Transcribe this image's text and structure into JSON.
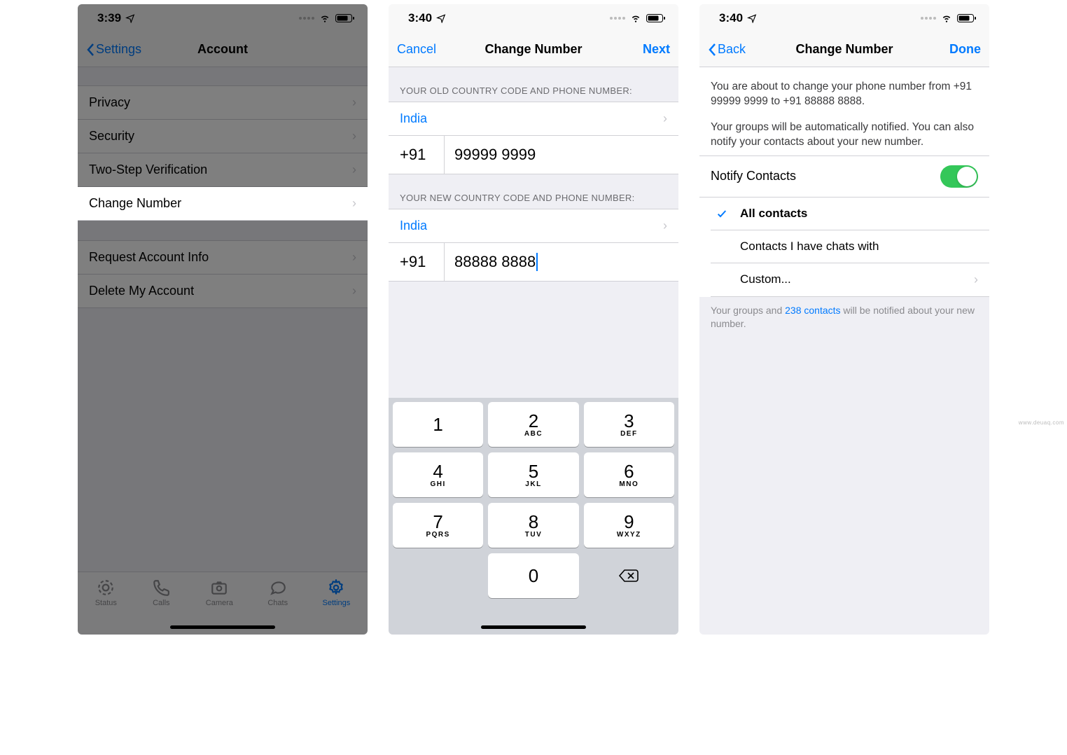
{
  "screen1": {
    "status_time": "3:39",
    "nav_back": "Settings",
    "nav_title": "Account",
    "rows_group1": [
      "Privacy",
      "Security",
      "Two-Step Verification",
      "Change Number"
    ],
    "rows_group2": [
      "Request Account Info",
      "Delete My Account"
    ],
    "tabs": [
      {
        "label": "Status"
      },
      {
        "label": "Calls"
      },
      {
        "label": "Camera"
      },
      {
        "label": "Chats"
      },
      {
        "label": "Settings"
      }
    ]
  },
  "screen2": {
    "status_time": "3:40",
    "nav_cancel": "Cancel",
    "nav_title": "Change Number",
    "nav_next": "Next",
    "section_old": "YOUR OLD COUNTRY CODE AND PHONE NUMBER:",
    "section_new": "YOUR NEW COUNTRY CODE AND PHONE NUMBER:",
    "old_country": "India",
    "old_cc": "+91",
    "old_number": "99999 9999",
    "new_country": "India",
    "new_cc": "+91",
    "new_number": "88888 8888",
    "keypad": [
      [
        {
          "d": "1",
          "l": ""
        },
        {
          "d": "2",
          "l": "ABC"
        },
        {
          "d": "3",
          "l": "DEF"
        }
      ],
      [
        {
          "d": "4",
          "l": "GHI"
        },
        {
          "d": "5",
          "l": "JKL"
        },
        {
          "d": "6",
          "l": "MNO"
        }
      ],
      [
        {
          "d": "7",
          "l": "PQRS"
        },
        {
          "d": "8",
          "l": "TUV"
        },
        {
          "d": "9",
          "l": "WXYZ"
        }
      ]
    ],
    "key_zero": "0"
  },
  "screen3": {
    "status_time": "3:40",
    "nav_back": "Back",
    "nav_title": "Change Number",
    "nav_done": "Done",
    "explain_1": "You are about to change your phone number from +91 99999 9999 to +91 88888 8888.",
    "explain_2": "Your groups will be automatically notified. You can also notify your contacts about your new number.",
    "notify_label": "Notify Contacts",
    "options": [
      {
        "label": "All contacts",
        "checked": true
      },
      {
        "label": "Contacts I have chats with",
        "checked": false
      },
      {
        "label": "Custom...",
        "checked": false,
        "disclosure": true
      }
    ],
    "footer_before": "Your groups and ",
    "footer_link": "238 contacts",
    "footer_after": " will be notified about your new number."
  }
}
